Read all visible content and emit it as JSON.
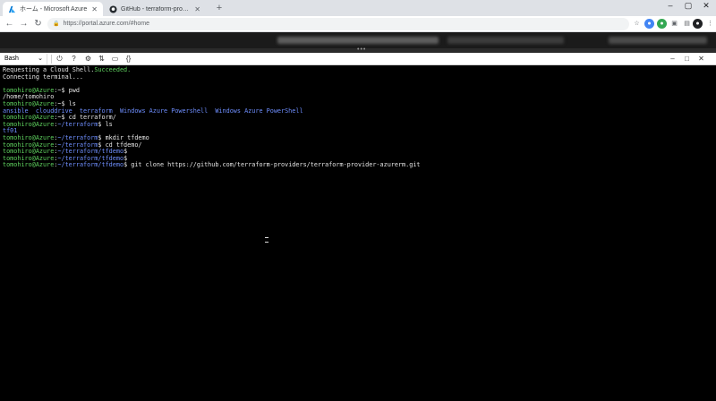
{
  "browser": {
    "tabs": [
      {
        "title": "ホーム - Microsoft Azure",
        "icon": "azure-icon",
        "active": true
      },
      {
        "title": "GitHub - terraform-providers/te",
        "icon": "github-icon",
        "active": false
      }
    ],
    "new_tab": "+",
    "url": "https://portal.azure.com/#home"
  },
  "shell": {
    "type": "Bash",
    "icons": [
      "power-icon",
      "help-icon",
      "settings-icon",
      "upload-download-icon",
      "open-editor-icon",
      "braces-icon"
    ]
  },
  "terminal": {
    "lines": [
      [
        {
          "t": "Requesting a Cloud Shell.",
          "c": "w"
        },
        {
          "t": "Succeeded.",
          "c": "g"
        }
      ],
      [
        {
          "t": "Connecting terminal...",
          "c": "w"
        }
      ],
      [],
      [
        {
          "t": "tomohiro@Azure",
          "c": "g"
        },
        {
          "t": ":~$ pwd",
          "c": "w"
        }
      ],
      [
        {
          "t": "/home/tomohiro",
          "c": "w"
        }
      ],
      [
        {
          "t": "tomohiro@Azure",
          "c": "g"
        },
        {
          "t": ":~$ ls",
          "c": "w"
        }
      ],
      [
        {
          "t": "ansible  clouddrive  terraform  Windows Azure Powershell  Windows Azure PowerShell",
          "c": "b"
        }
      ],
      [
        {
          "t": "tomohiro@Azure",
          "c": "g"
        },
        {
          "t": ":~$ cd terraform/",
          "c": "w"
        }
      ],
      [
        {
          "t": "tomohiro@Azure",
          "c": "g"
        },
        {
          "t": ":",
          "c": "w"
        },
        {
          "t": "~/terraform",
          "c": "b"
        },
        {
          "t": "$ ls",
          "c": "w"
        }
      ],
      [
        {
          "t": "tf01",
          "c": "b"
        }
      ],
      [
        {
          "t": "tomohiro@Azure",
          "c": "g"
        },
        {
          "t": ":",
          "c": "w"
        },
        {
          "t": "~/terraform",
          "c": "b"
        },
        {
          "t": "$ mkdir tfdemo",
          "c": "w"
        }
      ],
      [
        {
          "t": "tomohiro@Azure",
          "c": "g"
        },
        {
          "t": ":",
          "c": "w"
        },
        {
          "t": "~/terraform",
          "c": "b"
        },
        {
          "t": "$ cd tfdemo/",
          "c": "w"
        }
      ],
      [
        {
          "t": "tomohiro@Azure",
          "c": "g"
        },
        {
          "t": ":",
          "c": "w"
        },
        {
          "t": "~/terraform/tfdemo",
          "c": "b"
        },
        {
          "t": "$",
          "c": "w"
        }
      ],
      [
        {
          "t": "tomohiro@Azure",
          "c": "g"
        },
        {
          "t": ":",
          "c": "w"
        },
        {
          "t": "~/terraform/tfdemo",
          "c": "b"
        },
        {
          "t": "$",
          "c": "w"
        }
      ],
      [
        {
          "t": "tomohiro@Azure",
          "c": "g"
        },
        {
          "t": ":",
          "c": "w"
        },
        {
          "t": "~/terraform/tfdemo",
          "c": "b"
        },
        {
          "t": "$ git clone https://github.com/terraform-providers/terraform-provider-azurerm.git",
          "c": "w"
        }
      ]
    ]
  },
  "colors": {
    "prompt_green": "#5fd35f",
    "path_blue": "#6f8fff",
    "terminal_bg": "#000000"
  }
}
